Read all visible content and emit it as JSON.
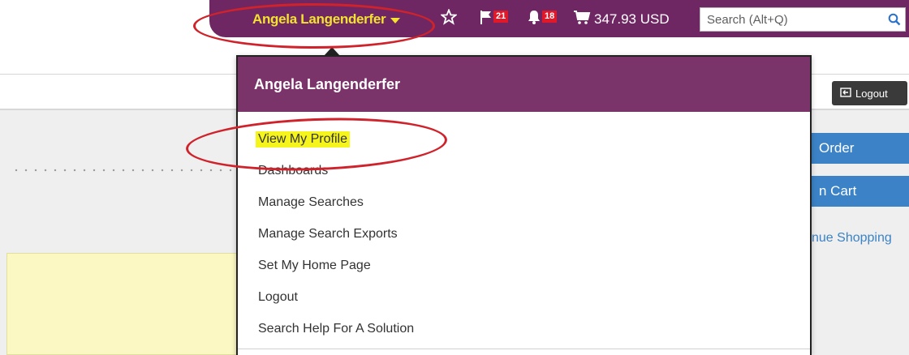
{
  "header": {
    "user_name": "Angela Langenderfer",
    "flag_count": "21",
    "notification_count": "18",
    "cart_total": "347.93 USD",
    "search_placeholder": "Search (Alt+Q)"
  },
  "actions": {
    "logout_label": "Logout",
    "order_label": "Order",
    "cart_label": "n Cart",
    "continue_label": "nue Shopping"
  },
  "dropdown": {
    "title": "Angela Langenderfer",
    "items": [
      {
        "label": "View My Profile"
      },
      {
        "label": "Dashboards"
      },
      {
        "label": "Manage Searches"
      },
      {
        "label": "Manage Search Exports"
      },
      {
        "label": "Set My Home Page"
      },
      {
        "label": "Logout"
      },
      {
        "label": "Search Help For A Solution"
      }
    ]
  },
  "colors": {
    "topbar": "#6e2763",
    "dropdown_header": "#7a3469",
    "user_name": "#f3e230",
    "badge": "#e0192a",
    "highlight": "#f5f51d",
    "annotation": "#d0222b",
    "primary_button": "#3b83c6"
  },
  "icons": [
    "caret-down-icon",
    "star-icon",
    "flag-icon",
    "bell-icon",
    "cart-icon",
    "search-icon",
    "logout-icon"
  ]
}
